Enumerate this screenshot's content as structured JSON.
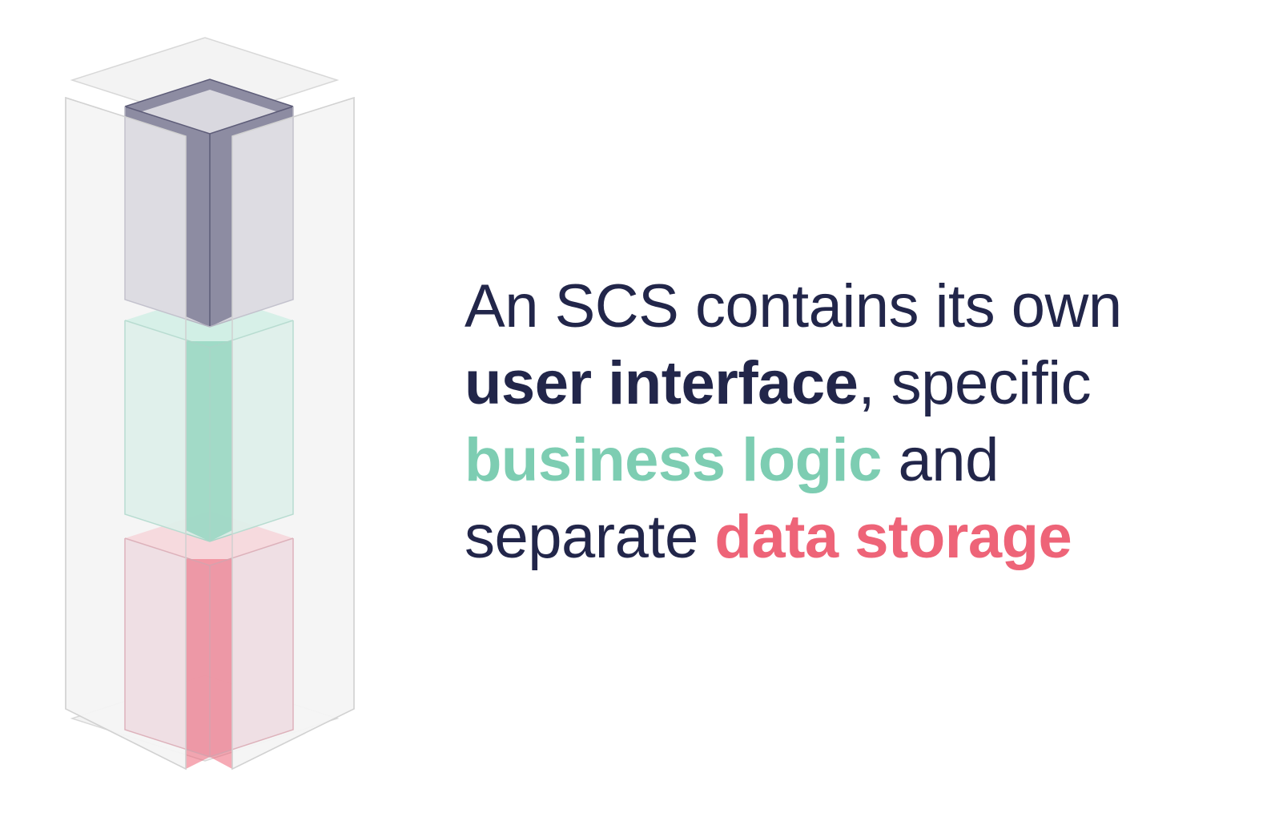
{
  "colors": {
    "text": "#22264a",
    "ui_layer": "#8d8ca2",
    "logic_layer": "#7dcdb2",
    "data_layer": "#ee6478",
    "frame": "#f3f3f3"
  },
  "caption": {
    "line1": "An SCS contains its own",
    "ui_term": "user interface",
    "line2_rest": ", specific",
    "logic_term": "business logic",
    "line3_rest": " and",
    "line4_start": "separate ",
    "data_term": "data storage"
  }
}
